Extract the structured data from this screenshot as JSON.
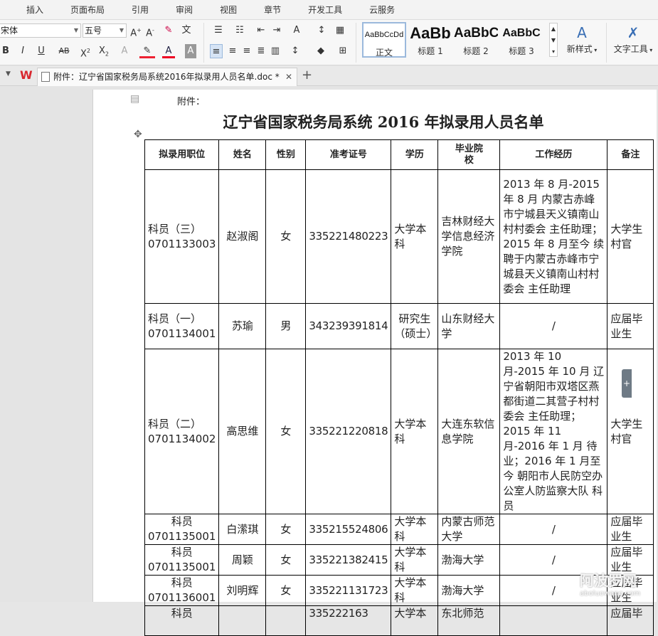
{
  "ribbon_tabs": [
    "插入",
    "页面布局",
    "引用",
    "审阅",
    "视图",
    "章节",
    "开发工具",
    "云服务"
  ],
  "font": {
    "name": "宋体",
    "size": "五号"
  },
  "styles": [
    {
      "preview": "AaBbCcDd",
      "name": "正文"
    },
    {
      "preview": "AaBb",
      "name": "标题 1"
    },
    {
      "preview": "AaBbC",
      "name": "标题 2"
    },
    {
      "preview": "AaBbC",
      "name": "标题 3"
    }
  ],
  "new_style_label": "新样式",
  "text_tools_label": "文字工具",
  "tab": {
    "title": "附件：辽宁省国家税务局系统2016年拟录用人员名单.doc *"
  },
  "doc": {
    "fujian": "附件：",
    "title": "辽宁省国家税务局系统 2016 年拟录用人员名单",
    "headers": [
      "拟录用职位",
      "姓名",
      "性别",
      "准考证号",
      "学历",
      "毕业院校",
      "工作经历",
      "备注"
    ],
    "rows": [
      {
        "pos": "科员（三）0701133003",
        "name": "赵淑阁",
        "sex": "女",
        "id": "335221480223",
        "edu": "大学本科",
        "school": "吉林财经大学信息经济学院",
        "exp": "2013 年 8 月-2015 年 8 月 内蒙古赤峰市宁城县天义镇南山村村委会 主任助理；2015 年 8 月至今 续聘于内蒙古赤峰市宁城县天义镇南山村村委会 主任助理",
        "note": "大学生村官"
      },
      {
        "pos": "科员（一）0701134001",
        "name": "苏瑜",
        "sex": "男",
        "id": "343239391814",
        "edu": "研究生（硕士）",
        "school": "山东财经大学",
        "exp": "/",
        "note": "应届毕业生"
      },
      {
        "pos": "科员（二）0701134002",
        "name": "高思维",
        "sex": "女",
        "id": "335221220818",
        "edu": "大学本科",
        "school": "大连东软信息学院",
        "exp": "2013 年 10 月-2015 年 10 月 辽宁省朝阳市双塔区燕都街道二其营子村村委会 主任助理；2015 年 11 月-2016 年 1 月 待业；2016 年 1 月至今 朝阳市人民防空办公室人防监察大队 科员",
        "note": "大学生村官"
      },
      {
        "pos": "科员 0701135001",
        "name": "白潆琪",
        "sex": "女",
        "id": "335215524806",
        "edu": "大学本科",
        "school": "内蒙古师范大学",
        "exp": "/",
        "note": "应届毕业生"
      },
      {
        "pos": "科员 0701135001",
        "name": "周颖",
        "sex": "女",
        "id": "335221382415",
        "edu": "大学本科",
        "school": "渤海大学",
        "exp": "/",
        "note": "应届毕业生"
      },
      {
        "pos": "科员 0701136001",
        "name": "刘明辉",
        "sex": "女",
        "id": "335221131723",
        "edu": "大学本科",
        "school": "渤海大学",
        "exp": "/",
        "note": "应届毕业生"
      },
      {
        "pos": "科员",
        "name": "",
        "sex": "",
        "id": "335222163",
        "edu": "大学本",
        "school": "东北师范",
        "exp": "",
        "note": "应届毕"
      }
    ]
  },
  "watermark": {
    "main": "阿波罗网",
    "sub": "aboluowang.com"
  }
}
